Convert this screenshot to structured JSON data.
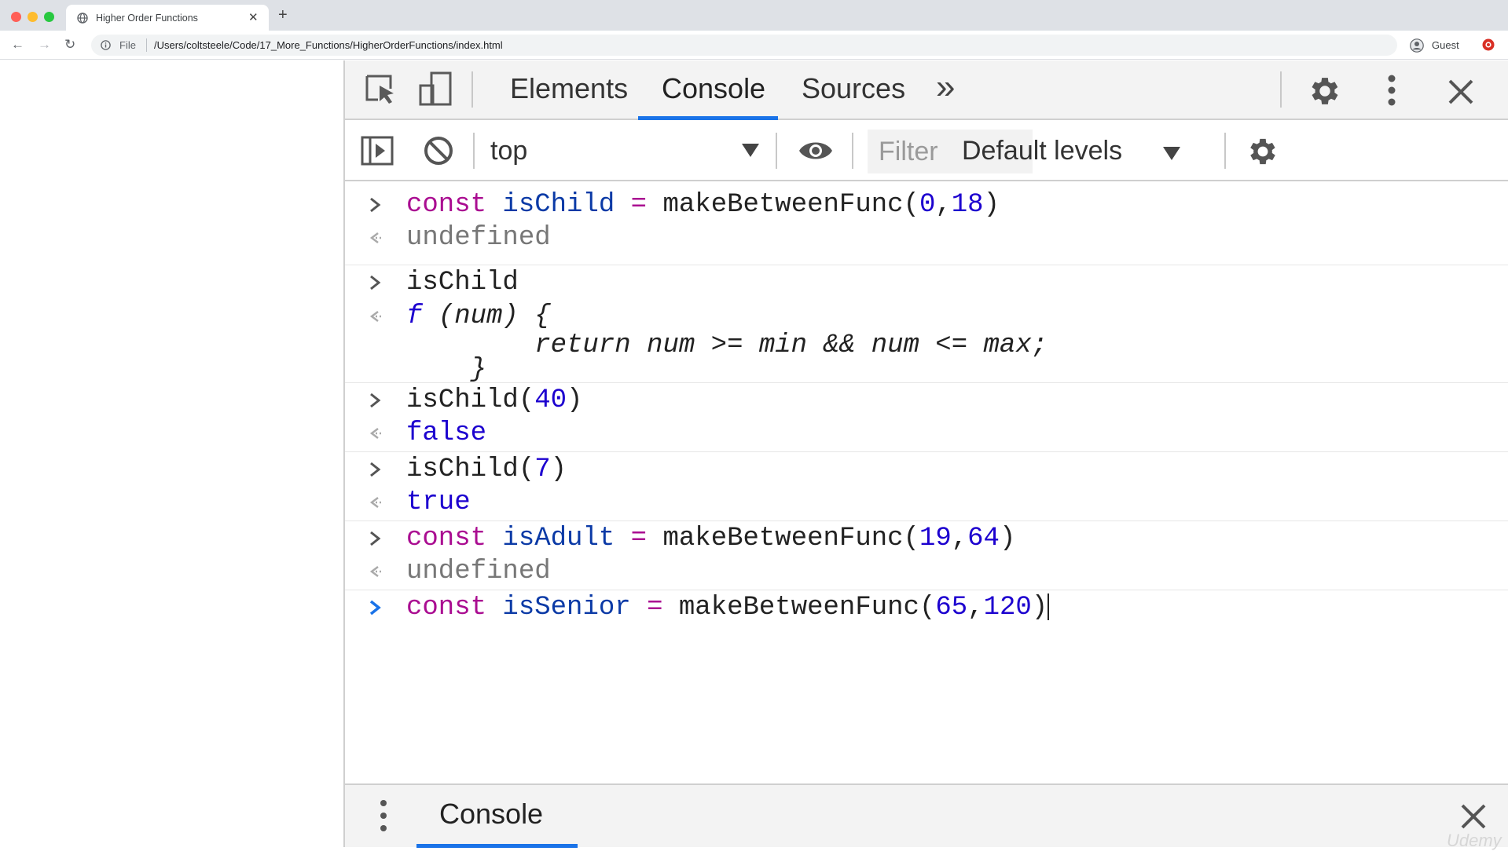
{
  "browser": {
    "tab_title": "Higher Order Functions",
    "tab_close": "✕",
    "new_tab": "+",
    "back": "←",
    "forward": "→",
    "reload": "↻",
    "omnibox_prefix": "File",
    "url": "/Users/coltsteele/Code/17_More_Functions/HigherOrderFunctions/index.html",
    "profile_label": "Guest"
  },
  "devtools": {
    "tabs": [
      {
        "label": "Elements",
        "active": false
      },
      {
        "label": "Console",
        "active": true
      },
      {
        "label": "Sources",
        "active": false
      }
    ],
    "more_tabs": "»",
    "context": "top",
    "filter_placeholder": "Filter",
    "levels": "Default levels",
    "drawer_tab": "Console",
    "watermark": "Udemy"
  },
  "console": {
    "entries": [
      {
        "input": [
          "const",
          " isChild ",
          "=",
          " makeBetweenFunc(",
          "0",
          ",",
          "18",
          ")"
        ],
        "output": "undefined"
      },
      {
        "input_plain": "isChild",
        "output_fn": [
          "f",
          " (num) {",
          "        return num >= min && num <= max;",
          "    }"
        ]
      },
      {
        "input_call": [
          "isChild(",
          "40",
          ")"
        ],
        "output_bool": "false"
      },
      {
        "input_call": [
          "isChild(",
          "7",
          ")"
        ],
        "output_bool": "true"
      },
      {
        "input": [
          "const",
          " isAdult ",
          "=",
          " makeBetweenFunc(",
          "19",
          ",",
          "64",
          ")"
        ],
        "output": "undefined"
      },
      {
        "input": [
          "const",
          " isSenior ",
          "=",
          " makeBetweenFunc(",
          "65",
          ",",
          "120",
          ")"
        ]
      }
    ]
  },
  "colors": {
    "keyword": "#aa0d91",
    "variable": "#0b3aa6",
    "number": "#1c00cf",
    "accent": "#1a73e8"
  }
}
